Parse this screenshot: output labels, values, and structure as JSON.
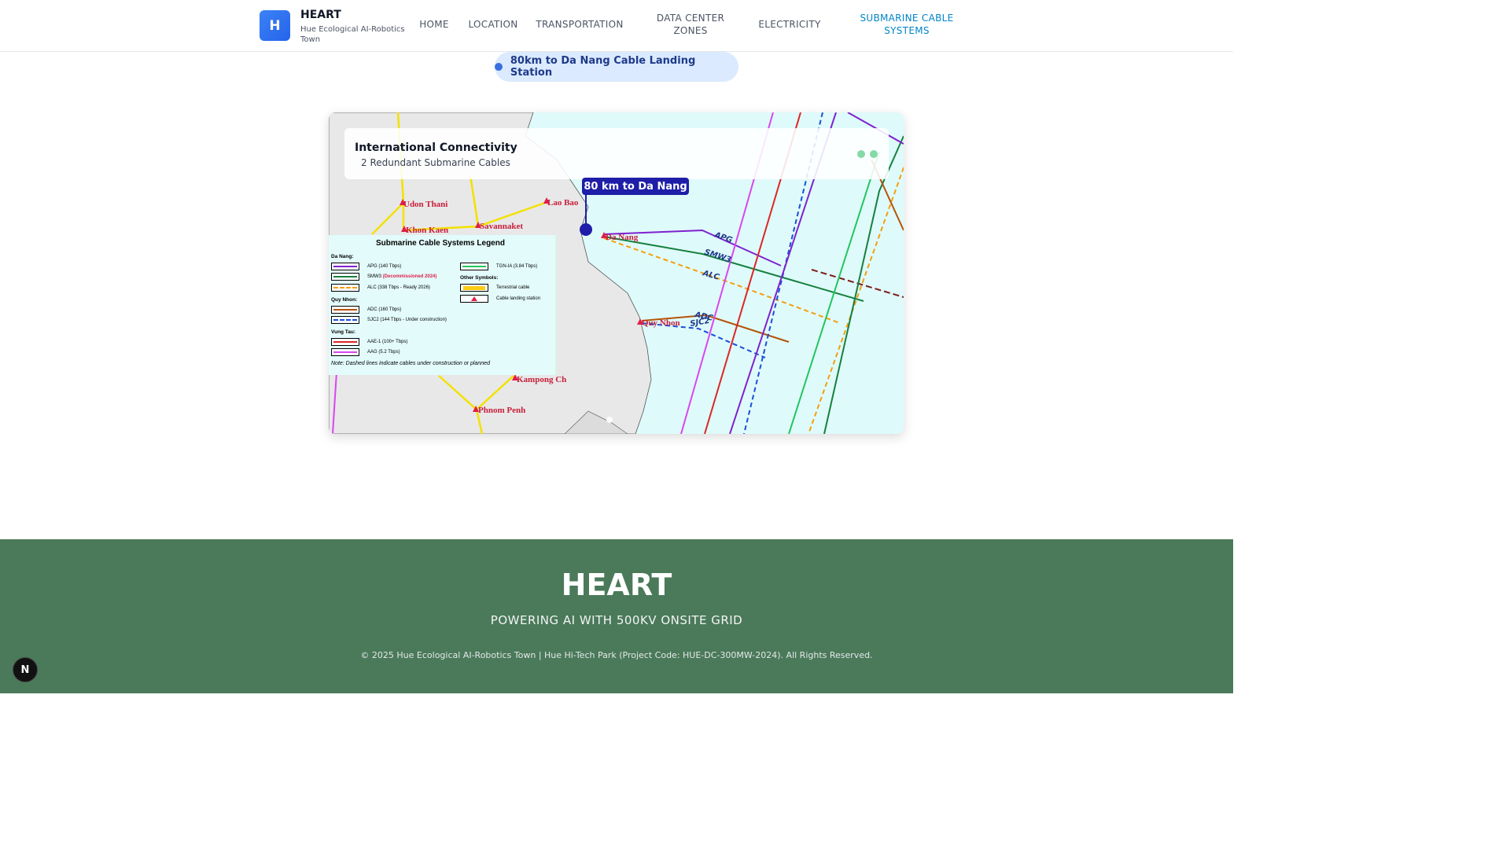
{
  "header": {
    "logo_letter": "H",
    "brand_name": "HEART",
    "brand_subtitle": "Hue Ecological AI-Robotics Town",
    "nav": [
      {
        "label": "HOME"
      },
      {
        "label": "LOCATION"
      },
      {
        "label": "TRANSPORTATION"
      },
      {
        "label": "DATA CENTER ZONES"
      },
      {
        "label": "ELECTRICITY"
      },
      {
        "label": "SUBMARINE CABLE SYSTEMS",
        "active": true
      }
    ]
  },
  "pill": {
    "text": "80km to Da Nang Cable Landing Station"
  },
  "map_card": {
    "title": "International Connectivity",
    "subtitle": "2 Redundant Submarine Cables",
    "callout": "80 km to Da Nang",
    "place_labels": [
      "Udon Thani",
      "Lao Bao",
      "Khon Kaen",
      "Savannaket",
      "Da Nang",
      "Quy Nhon",
      "Kampong Ch",
      "Phnom Penh"
    ],
    "cable_labels": [
      "APG",
      "SMW3",
      "ALC",
      "ADC",
      "SJC2"
    ],
    "legend": {
      "title": "Submarine Cable Systems Legend",
      "groups": [
        {
          "heading": "Da Nang:",
          "items": [
            {
              "label": "APG (140 Tbps)",
              "color": "#7e22ce",
              "dashed": false
            },
            {
              "label": "SMW3",
              "suffix": "(Decommissioned 2024)",
              "color": "#15803d",
              "dashed": false
            },
            {
              "label": "ALC (338 Tbps - Ready 2026)",
              "color": "#f59e0b",
              "dashed": true
            }
          ]
        },
        {
          "heading": "Quy Nhon:",
          "items": [
            {
              "label": "ADC (160 Tbps)",
              "color": "#b45309",
              "dashed": false
            },
            {
              "label": "SJC2 (144 Tbps - Under construction)",
              "color": "#1d4ed8",
              "dashed": true
            }
          ]
        },
        {
          "heading": "Vung Tau:",
          "items": [
            {
              "label": "AAE-1 (100+ Tbps)",
              "color": "#dc2626",
              "dashed": false
            },
            {
              "label": "AAG (5.2 Tbps)",
              "color": "#d946ef",
              "dashed": false
            }
          ]
        }
      ],
      "right_items": [
        {
          "label": "TGN-IA (3.84 Tbps)",
          "color": "#22c55e",
          "dashed": false
        }
      ],
      "other_heading": "Other Symbols:",
      "other_items": [
        {
          "label": "Terrestrial cable",
          "color": "#facc15"
        },
        {
          "label": "Cable landing station",
          "color": "#e11d48"
        }
      ],
      "note": "Note: Dashed lines indicate cables under construction or planned"
    }
  },
  "footer": {
    "title": "HEART",
    "tagline": "POWERING AI WITH 500KV ONSITE GRID",
    "copyright": "© 2025 Hue Ecological AI-Robotics Town | Hue Hi-Tech Park (Project Code: HUE-DC-300MW-2024). All Rights Reserved."
  },
  "dev_badge": "N"
}
